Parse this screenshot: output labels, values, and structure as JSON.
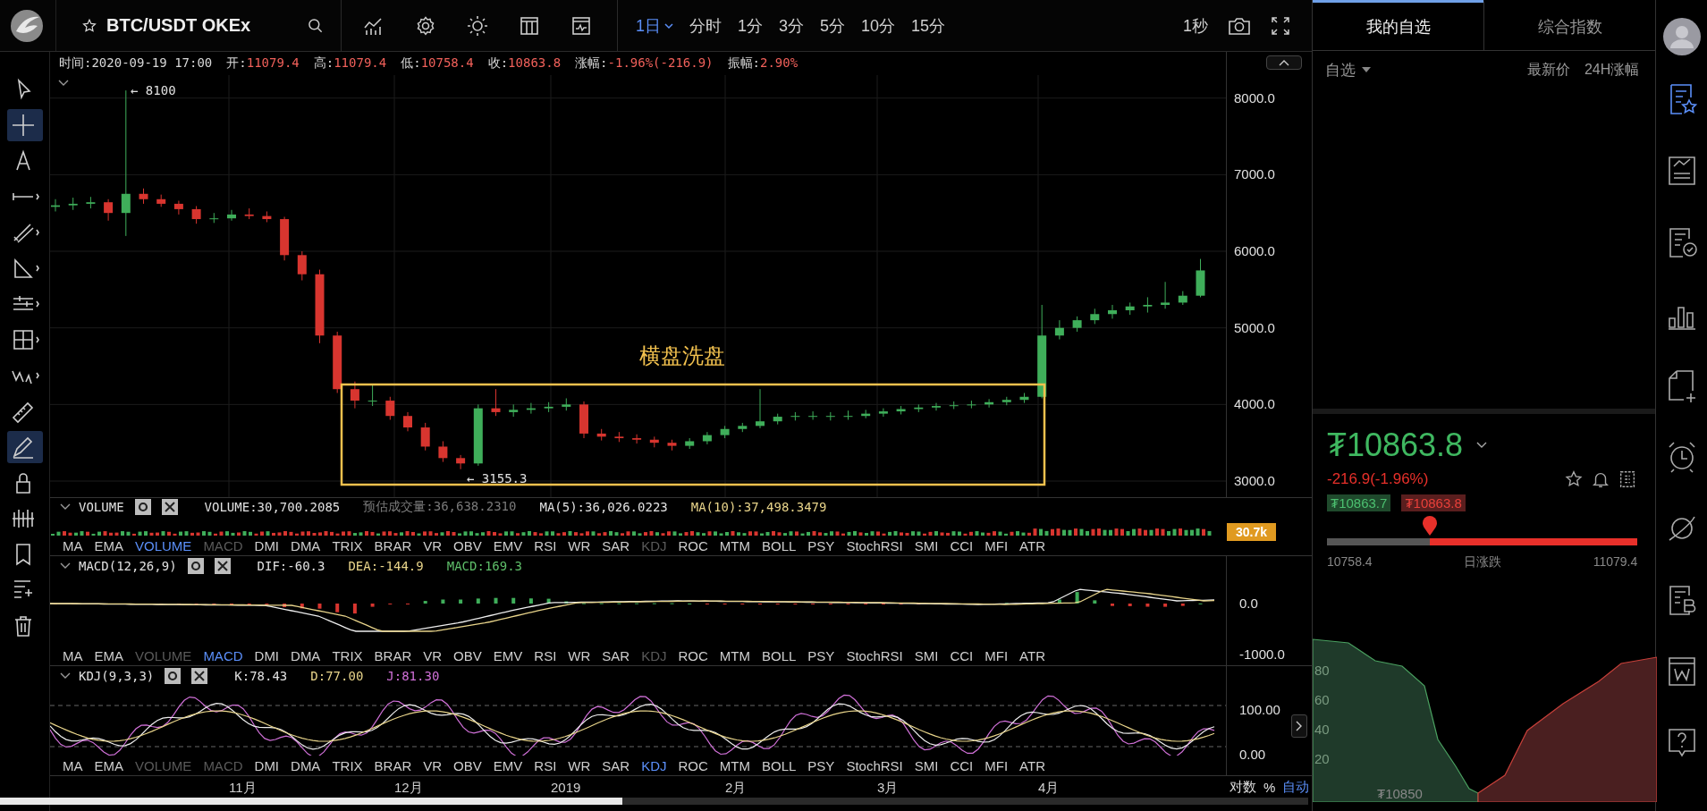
{
  "toolbar": {
    "symbol": "BTC/USDT OKEx",
    "intervals": [
      {
        "label": "1日",
        "selected": true
      },
      {
        "label": "分时",
        "selected": false
      },
      {
        "label": "1分",
        "selected": false
      },
      {
        "label": "3分",
        "selected": false
      },
      {
        "label": "5分",
        "selected": false
      },
      {
        "label": "10分",
        "selected": false
      },
      {
        "label": "15分",
        "selected": false
      }
    ],
    "refresh": "1秒"
  },
  "tools": [
    {
      "kind": "cursor",
      "selected": false,
      "has_menu": false
    },
    {
      "kind": "crosshair",
      "selected": true,
      "has_menu": false
    },
    {
      "kind": "text",
      "selected": false,
      "has_menu": false
    },
    {
      "kind": "hline",
      "selected": false,
      "has_menu": true
    },
    {
      "kind": "parallel",
      "selected": false,
      "has_menu": true
    },
    {
      "kind": "triangle",
      "selected": false,
      "has_menu": true
    },
    {
      "kind": "fib",
      "selected": false,
      "has_menu": true
    },
    {
      "kind": "rect",
      "selected": false,
      "has_menu": true
    },
    {
      "kind": "wave",
      "selected": false,
      "has_menu": true
    },
    {
      "kind": "ruler",
      "selected": false,
      "has_menu": false
    },
    {
      "kind": "pen",
      "selected": true,
      "has_menu": false
    },
    {
      "kind": "lock",
      "selected": false,
      "has_menu": false
    },
    {
      "kind": "bars",
      "selected": false,
      "has_menu": false
    },
    {
      "kind": "bookmark",
      "selected": false,
      "has_menu": false
    },
    {
      "kind": "list",
      "selected": false,
      "has_menu": false
    },
    {
      "kind": "trash",
      "selected": false,
      "has_menu": false
    }
  ],
  "info": [
    {
      "label": "时间:",
      "value": "2020-09-19 17:00",
      "color": "#d8d8d8"
    },
    {
      "label": "开:",
      "value": "11079.4",
      "color": "#f0605a"
    },
    {
      "label": "高:",
      "value": "11079.4",
      "color": "#f0605a"
    },
    {
      "label": "低:",
      "value": "10758.4",
      "color": "#f0605a"
    },
    {
      "label": "收:",
      "value": "10863.8",
      "color": "#f0605a"
    },
    {
      "label": "涨幅:",
      "value": "-1.96%(-216.9)",
      "color": "#f0605a"
    },
    {
      "label": "振幅:",
      "value": "2.90%",
      "color": "#f0605a"
    }
  ],
  "main_chart": {
    "chart_data": {
      "type": "candlestick",
      "yticks": [
        {
          "value": 8000,
          "label": "8000.0"
        },
        {
          "value": 7000,
          "label": "7000.0"
        },
        {
          "value": 6000,
          "label": "6000.0"
        },
        {
          "value": 5000,
          "label": "5000.0"
        },
        {
          "value": 4000,
          "label": "4000.0"
        },
        {
          "value": 3000,
          "label": "3000.0"
        }
      ],
      "grid": true,
      "ylim": [
        2790,
        8300
      ],
      "ohlc": [
        [
          6580,
          6680,
          6520,
          6600
        ],
        [
          6600,
          6700,
          6540,
          6620
        ],
        [
          6620,
          6710,
          6560,
          6640
        ],
        [
          6640,
          6680,
          6400,
          6500
        ],
        [
          6500,
          8100,
          6200,
          6750
        ],
        [
          6750,
          6820,
          6620,
          6680
        ],
        [
          6680,
          6740,
          6580,
          6620
        ],
        [
          6620,
          6660,
          6480,
          6550
        ],
        [
          6550,
          6590,
          6360,
          6420
        ],
        [
          6420,
          6500,
          6370,
          6430
        ],
        [
          6430,
          6540,
          6400,
          6480
        ],
        [
          6480,
          6560,
          6420,
          6460
        ],
        [
          6460,
          6520,
          6380,
          6420
        ],
        [
          6420,
          6450,
          5880,
          5950
        ],
        [
          5950,
          6000,
          5620,
          5700
        ],
        [
          5700,
          5760,
          4800,
          4900
        ],
        [
          4900,
          4950,
          4150,
          4200
        ],
        [
          4200,
          4300,
          3950,
          4050
        ],
        [
          4050,
          4250,
          3980,
          4050
        ],
        [
          4050,
          4100,
          3800,
          3850
        ],
        [
          3850,
          3900,
          3650,
          3700
        ],
        [
          3700,
          3760,
          3400,
          3450
        ],
        [
          3450,
          3520,
          3250,
          3300
        ],
        [
          3300,
          3340,
          3155,
          3230
        ],
        [
          3230,
          4000,
          3200,
          3950
        ],
        [
          3950,
          4200,
          3850,
          3900
        ],
        [
          3900,
          4000,
          3840,
          3930
        ],
        [
          3930,
          4020,
          3880,
          3950
        ],
        [
          3950,
          4030,
          3900,
          3970
        ],
        [
          3970,
          4080,
          3920,
          4000
        ],
        [
          4000,
          4040,
          3560,
          3620
        ],
        [
          3620,
          3680,
          3530,
          3580
        ],
        [
          3580,
          3640,
          3510,
          3560
        ],
        [
          3560,
          3610,
          3490,
          3540
        ],
        [
          3540,
          3580,
          3440,
          3500
        ],
        [
          3500,
          3540,
          3400,
          3460
        ],
        [
          3460,
          3560,
          3420,
          3520
        ],
        [
          3520,
          3640,
          3480,
          3600
        ],
        [
          3600,
          3720,
          3560,
          3680
        ],
        [
          3680,
          3760,
          3640,
          3720
        ],
        [
          3720,
          4200,
          3690,
          3780
        ],
        [
          3780,
          3880,
          3740,
          3840
        ],
        [
          3840,
          3900,
          3790,
          3850
        ],
        [
          3850,
          3910,
          3800,
          3850
        ],
        [
          3850,
          3900,
          3790,
          3850
        ],
        [
          3850,
          3920,
          3800,
          3850
        ],
        [
          3850,
          3930,
          3820,
          3880
        ],
        [
          3880,
          3950,
          3840,
          3910
        ],
        [
          3910,
          3980,
          3870,
          3940
        ],
        [
          3940,
          4000,
          3900,
          3960
        ],
        [
          3960,
          4020,
          3920,
          3980
        ],
        [
          3980,
          4040,
          3940,
          3990
        ],
        [
          3990,
          4050,
          3950,
          4000
        ],
        [
          4000,
          4070,
          3960,
          4030
        ],
        [
          4030,
          4100,
          3990,
          4060
        ],
        [
          4060,
          4150,
          4020,
          4100
        ],
        [
          4100,
          5300,
          4080,
          4900
        ],
        [
          4900,
          5100,
          4850,
          5000
        ],
        [
          5000,
          5150,
          4950,
          5100
        ],
        [
          5100,
          5250,
          5050,
          5180
        ],
        [
          5180,
          5300,
          5120,
          5230
        ],
        [
          5230,
          5330,
          5170,
          5280
        ],
        [
          5280,
          5400,
          5200,
          5300
        ],
        [
          5300,
          5600,
          5250,
          5330
        ],
        [
          5330,
          5480,
          5300,
          5420
        ],
        [
          5420,
          5900,
          5400,
          5750
        ]
      ]
    },
    "high_marker": "← 8100",
    "low_marker": "← 3155.3",
    "annotation": "横盘洗盘"
  },
  "panes": [
    {
      "kind": "volume",
      "name": "VOLUME",
      "legend": [
        {
          "text": "VOLUME:30,700.2085",
          "color": "#e0e0e0"
        },
        {
          "text": "预估成交量:36,638.2310",
          "color": "#7a7a7a"
        },
        {
          "text": "MA(5):36,026.0223",
          "color": "#e0e0e0"
        },
        {
          "text": "MA(10):37,498.3479",
          "color": "#e8d48a"
        }
      ],
      "badge": "30.7k",
      "tabs": [
        {
          "label": "MA",
          "selected": false,
          "dimmed": false
        },
        {
          "label": "EMA",
          "selected": false,
          "dimmed": false
        },
        {
          "label": "VOLUME",
          "selected": true,
          "dimmed": false
        },
        {
          "label": "MACD",
          "selected": false,
          "dimmed": true
        },
        {
          "label": "DMI",
          "selected": false,
          "dimmed": false
        },
        {
          "label": "DMA",
          "selected": false,
          "dimmed": false
        },
        {
          "label": "TRIX",
          "selected": false,
          "dimmed": false
        },
        {
          "label": "BRAR",
          "selected": false,
          "dimmed": false
        },
        {
          "label": "VR",
          "selected": false,
          "dimmed": false
        },
        {
          "label": "OBV",
          "selected": false,
          "dimmed": false
        },
        {
          "label": "EMV",
          "selected": false,
          "dimmed": false
        },
        {
          "label": "RSI",
          "selected": false,
          "dimmed": false
        },
        {
          "label": "WR",
          "selected": false,
          "dimmed": false
        },
        {
          "label": "SAR",
          "selected": false,
          "dimmed": false
        },
        {
          "label": "KDJ",
          "selected": false,
          "dimmed": true
        },
        {
          "label": "ROC",
          "selected": false,
          "dimmed": false
        },
        {
          "label": "MTM",
          "selected": false,
          "dimmed": false
        },
        {
          "label": "BOLL",
          "selected": false,
          "dimmed": false
        },
        {
          "label": "PSY",
          "selected": false,
          "dimmed": false
        },
        {
          "label": "StochRSI",
          "selected": false,
          "dimmed": false
        },
        {
          "label": "SMI",
          "selected": false,
          "dimmed": false
        },
        {
          "label": "CCI",
          "selected": false,
          "dimmed": false
        },
        {
          "label": "MFI",
          "selected": false,
          "dimmed": false
        },
        {
          "label": "ATR",
          "selected": false,
          "dimmed": false
        }
      ]
    },
    {
      "kind": "macd",
      "name": "MACD(12,26,9)",
      "legend": [
        {
          "text": "DIF:-60.3",
          "color": "#e0e0e0"
        },
        {
          "text": "DEA:-144.9",
          "color": "#e8d48a"
        },
        {
          "text": "MACD:169.3",
          "color": "#5fbf6a"
        }
      ],
      "axis": [
        "0.0",
        "-1000.0"
      ],
      "tabs": [
        {
          "label": "MA",
          "selected": false,
          "dimmed": false
        },
        {
          "label": "EMA",
          "selected": false,
          "dimmed": false
        },
        {
          "label": "VOLUME",
          "selected": false,
          "dimmed": true
        },
        {
          "label": "MACD",
          "selected": true,
          "dimmed": false
        },
        {
          "label": "DMI",
          "selected": false,
          "dimmed": false
        },
        {
          "label": "DMA",
          "selected": false,
          "dimmed": false
        },
        {
          "label": "TRIX",
          "selected": false,
          "dimmed": false
        },
        {
          "label": "BRAR",
          "selected": false,
          "dimmed": false
        },
        {
          "label": "VR",
          "selected": false,
          "dimmed": false
        },
        {
          "label": "OBV",
          "selected": false,
          "dimmed": false
        },
        {
          "label": "EMV",
          "selected": false,
          "dimmed": false
        },
        {
          "label": "RSI",
          "selected": false,
          "dimmed": false
        },
        {
          "label": "WR",
          "selected": false,
          "dimmed": false
        },
        {
          "label": "SAR",
          "selected": false,
          "dimmed": false
        },
        {
          "label": "KDJ",
          "selected": false,
          "dimmed": true
        },
        {
          "label": "ROC",
          "selected": false,
          "dimmed": false
        },
        {
          "label": "MTM",
          "selected": false,
          "dimmed": false
        },
        {
          "label": "BOLL",
          "selected": false,
          "dimmed": false
        },
        {
          "label": "PSY",
          "selected": false,
          "dimmed": false
        },
        {
          "label": "StochRSI",
          "selected": false,
          "dimmed": false
        },
        {
          "label": "SMI",
          "selected": false,
          "dimmed": false
        },
        {
          "label": "CCI",
          "selected": false,
          "dimmed": false
        },
        {
          "label": "MFI",
          "selected": false,
          "dimmed": false
        },
        {
          "label": "ATR",
          "selected": false,
          "dimmed": false
        }
      ]
    },
    {
      "kind": "kdj",
      "name": "KDJ(9,3,3)",
      "legend": [
        {
          "text": "K:78.43",
          "color": "#e0e0e0"
        },
        {
          "text": "D:77.00",
          "color": "#e8d48a"
        },
        {
          "text": "J:81.30",
          "color": "#d070d8"
        }
      ],
      "axis": [
        "100.00",
        "0.00"
      ],
      "tabs": [
        {
          "label": "MA",
          "selected": false,
          "dimmed": false
        },
        {
          "label": "EMA",
          "selected": false,
          "dimmed": false
        },
        {
          "label": "VOLUME",
          "selected": false,
          "dimmed": true
        },
        {
          "label": "MACD",
          "selected": false,
          "dimmed": true
        },
        {
          "label": "DMI",
          "selected": false,
          "dimmed": false
        },
        {
          "label": "DMA",
          "selected": false,
          "dimmed": false
        },
        {
          "label": "TRIX",
          "selected": false,
          "dimmed": false
        },
        {
          "label": "BRAR",
          "selected": false,
          "dimmed": false
        },
        {
          "label": "VR",
          "selected": false,
          "dimmed": false
        },
        {
          "label": "OBV",
          "selected": false,
          "dimmed": false
        },
        {
          "label": "EMV",
          "selected": false,
          "dimmed": false
        },
        {
          "label": "RSI",
          "selected": false,
          "dimmed": false
        },
        {
          "label": "WR",
          "selected": false,
          "dimmed": false
        },
        {
          "label": "SAR",
          "selected": false,
          "dimmed": false
        },
        {
          "label": "KDJ",
          "selected": true,
          "dimmed": false
        },
        {
          "label": "ROC",
          "selected": false,
          "dimmed": false
        },
        {
          "label": "MTM",
          "selected": false,
          "dimmed": false
        },
        {
          "label": "BOLL",
          "selected": false,
          "dimmed": false
        },
        {
          "label": "PSY",
          "selected": false,
          "dimmed": false
        },
        {
          "label": "StochRSI",
          "selected": false,
          "dimmed": false
        },
        {
          "label": "SMI",
          "selected": false,
          "dimmed": false
        },
        {
          "label": "CCI",
          "selected": false,
          "dimmed": false
        },
        {
          "label": "MFI",
          "selected": false,
          "dimmed": false
        },
        {
          "label": "ATR",
          "selected": false,
          "dimmed": false
        }
      ]
    }
  ],
  "date_axis": {
    "labels": [
      "11月",
      "12月",
      "2019",
      "2月",
      "3月",
      "4月"
    ],
    "controls": [
      {
        "label": "对数",
        "active": false
      },
      {
        "label": "%",
        "active": false
      },
      {
        "label": "自动",
        "active": true
      }
    ]
  },
  "side_panel": {
    "tabs": [
      {
        "label": "我的自选",
        "selected": true
      },
      {
        "label": "综合指数",
        "selected": false
      }
    ],
    "filter": "自选",
    "columns": [
      "最新价",
      "24H涨幅"
    ],
    "price": "₮10863.8",
    "change": "-216.9(-1.96%)",
    "bid": "₮10863.7",
    "ask": "₮10863.8",
    "range": {
      "low": "10758.4",
      "label": "日涨跌",
      "high": "11079.4",
      "level": 0.33
    },
    "depth": {
      "y_ticks": [
        "80",
        "60",
        "40",
        "20"
      ],
      "x_label": "₮10850"
    }
  },
  "nav_icons": [
    {
      "kind": "watchlist",
      "selected": true
    },
    {
      "kind": "trend-doc",
      "selected": false
    },
    {
      "kind": "check-doc",
      "selected": false
    },
    {
      "kind": "bar-chart",
      "selected": false
    },
    {
      "kind": "new-doc",
      "selected": false
    },
    {
      "kind": "alarm",
      "selected": false
    },
    {
      "kind": "planet",
      "selected": false
    },
    {
      "kind": "b-doc",
      "selected": false
    },
    {
      "kind": "w-window",
      "selected": false
    },
    {
      "kind": "help",
      "selected": false
    }
  ]
}
